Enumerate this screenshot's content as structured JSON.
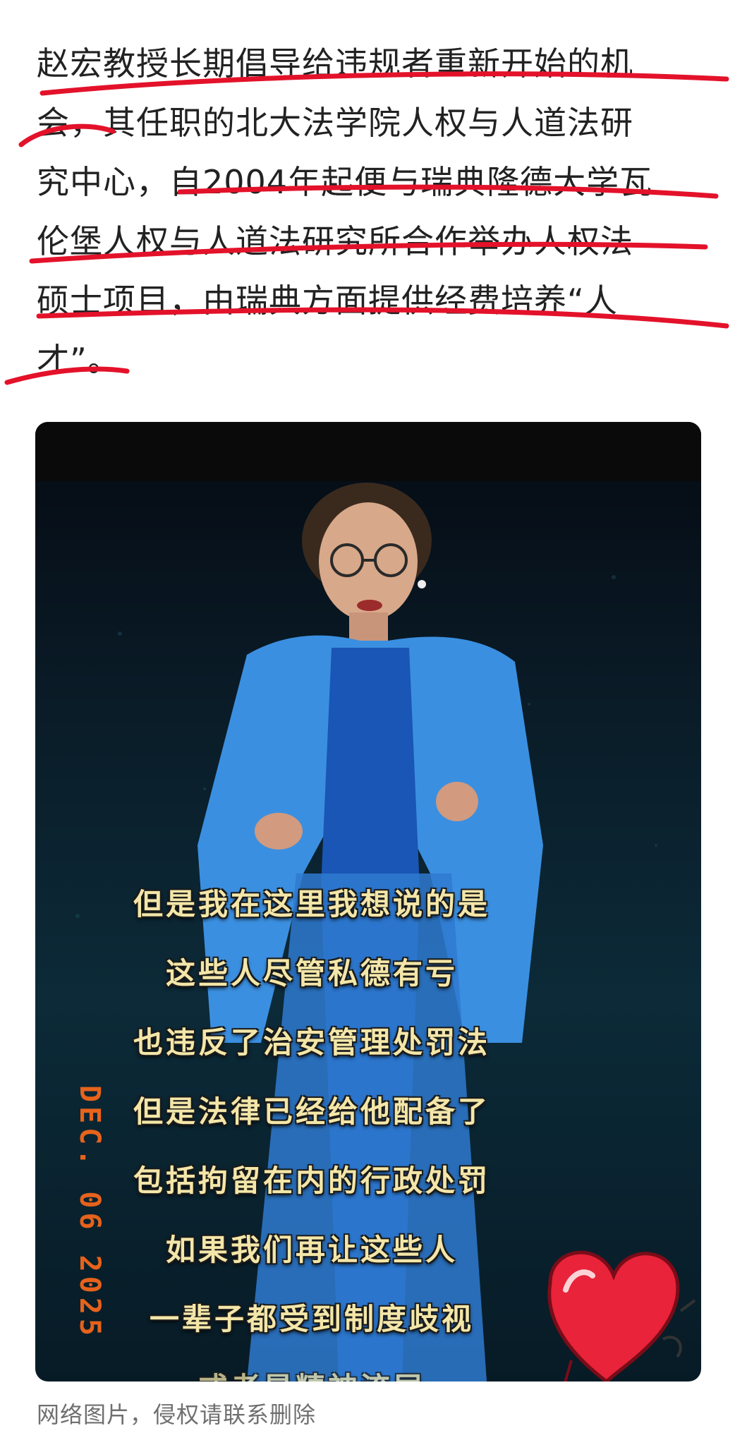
{
  "article": {
    "lines": [
      "赵宏教授长期倡导给违规者重新开始的机",
      "会，其任职的北大法学院人权与人道法研",
      "究中心，自2004年起便与瑞典隆德大学瓦",
      "伦堡人权与人道法研究所合作举办人权法",
      "硕士项目，由瑞典方面提供经费培养“人",
      "才”。"
    ]
  },
  "video": {
    "subtitles": [
      "但是我在这里我想说的是",
      "这些人尽管私德有亏",
      "也违反了治安管理处罚法",
      "但是法律已经给他配备了",
      "包括拘留在内的行政处罚",
      "如果我们再让这些人",
      "一辈子都受到制度歧视",
      "或者是精神流层"
    ],
    "date_stamp": "DEC. 06 2025"
  },
  "caption": "网络图片，侵权请联系删除",
  "colors": {
    "annotation_red": "#e3122a",
    "jacket_blue": "#3b8fe0",
    "subtitle_yellow": "#f3e6a8",
    "stamp_orange": "#ff6a1a"
  },
  "icons": [
    "heart-sticker-icon"
  ]
}
